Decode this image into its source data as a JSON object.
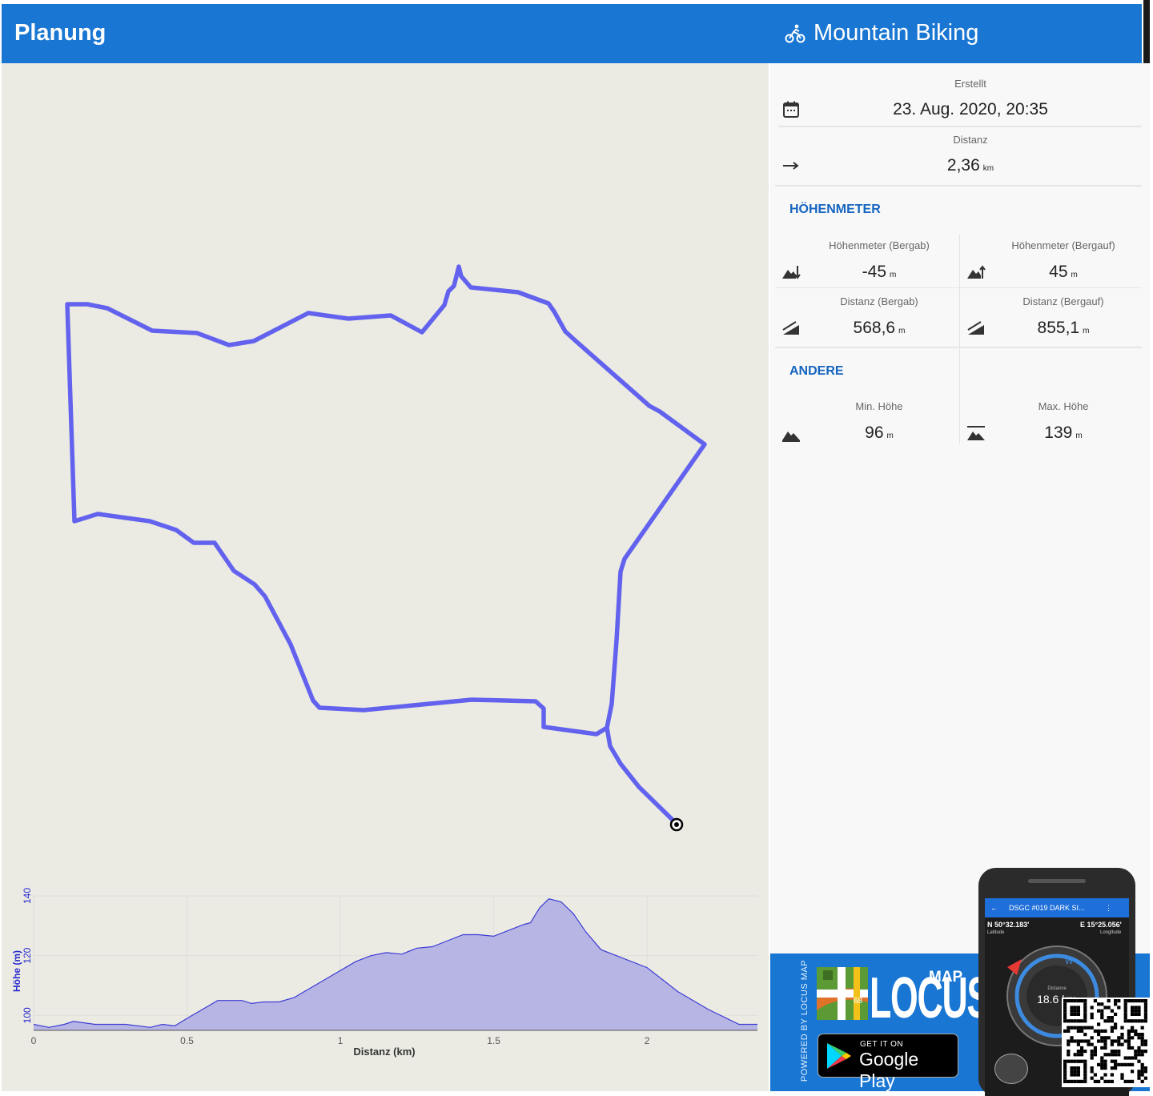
{
  "header": {
    "title": "Planung",
    "activity": "Mountain Biking"
  },
  "details": {
    "created_label": "Erstellt",
    "created_value": "23. Aug. 2020, 20:35",
    "distance_label": "Distanz",
    "distance_value": "2,36",
    "distance_unit": "km"
  },
  "elevation_section": {
    "title": "HÖHENMETER",
    "descent_label": "Höhenmeter (Bergab)",
    "descent_value": "-45",
    "ascent_label": "Höhenmeter (Bergauf)",
    "ascent_value": "45",
    "dist_down_label": "Distanz (Bergab)",
    "dist_down_value": "568,6",
    "dist_up_label": "Distanz (Bergauf)",
    "dist_up_value": "855,1",
    "unit": "m"
  },
  "other_section": {
    "title": "ANDERE",
    "min_label": "Min. Höhe",
    "min_value": "96",
    "max_label": "Max. Höhe",
    "max_value": "139",
    "unit": "m"
  },
  "elevation_chart": {
    "xlabel": "Distanz (km)",
    "ylabel": "Höhe (m)",
    "x_ticks": [
      "0",
      "0.5",
      "1",
      "1.5",
      "2"
    ],
    "y_ticks": [
      "100",
      "120",
      "140"
    ]
  },
  "chart_data": {
    "type": "area",
    "xlabel": "Distanz (km)",
    "ylabel": "Höhe (m)",
    "xlim": [
      0,
      2.36
    ],
    "ylim": [
      95,
      140
    ],
    "series": [
      {
        "x": [
          0,
          0.05,
          0.1,
          0.13,
          0.2,
          0.3,
          0.38,
          0.42,
          0.46,
          0.5,
          0.55,
          0.6,
          0.68,
          0.71,
          0.75,
          0.8,
          0.85,
          0.95,
          1.05,
          1.1,
          1.15,
          1.2,
          1.25,
          1.3,
          1.35,
          1.4,
          1.45,
          1.5,
          1.55,
          1.6,
          1.62,
          1.65,
          1.68,
          1.72,
          1.76,
          1.8,
          1.85,
          1.9,
          2.0,
          2.05,
          2.1,
          2.2,
          2.3,
          2.36
        ],
        "y": [
          97,
          96,
          97,
          98,
          97,
          97,
          96,
          97,
          96.5,
          99,
          102,
          105,
          105,
          104,
          104.5,
          104.5,
          106,
          112,
          118,
          120,
          121,
          120.5,
          122.5,
          123,
          125,
          127,
          127,
          126.5,
          128.5,
          130.5,
          131,
          136,
          139,
          138,
          134,
          128,
          122,
          120,
          116,
          112,
          108,
          102,
          97,
          97
        ]
      }
    ]
  },
  "promo": {
    "powered_by": "POWERED BY LOCUS MAP",
    "brand": "LOCUS",
    "brand_sub": "MAP",
    "play_top": "GET IT ON",
    "play_main": "Google Play",
    "phone_title": "DSGC #019 DARK SI...",
    "phone_lat": "N 50°32.183'",
    "phone_lon": "E 15°25.056'",
    "phone_lat_label": "Latitude",
    "phone_lon_label": "Longitude",
    "phone_distance": "18.6 km"
  },
  "colors": {
    "primary": "#1976d2",
    "track": "#6262ee",
    "map_bg": "#ebebe3",
    "section_title": "#1565c0"
  }
}
